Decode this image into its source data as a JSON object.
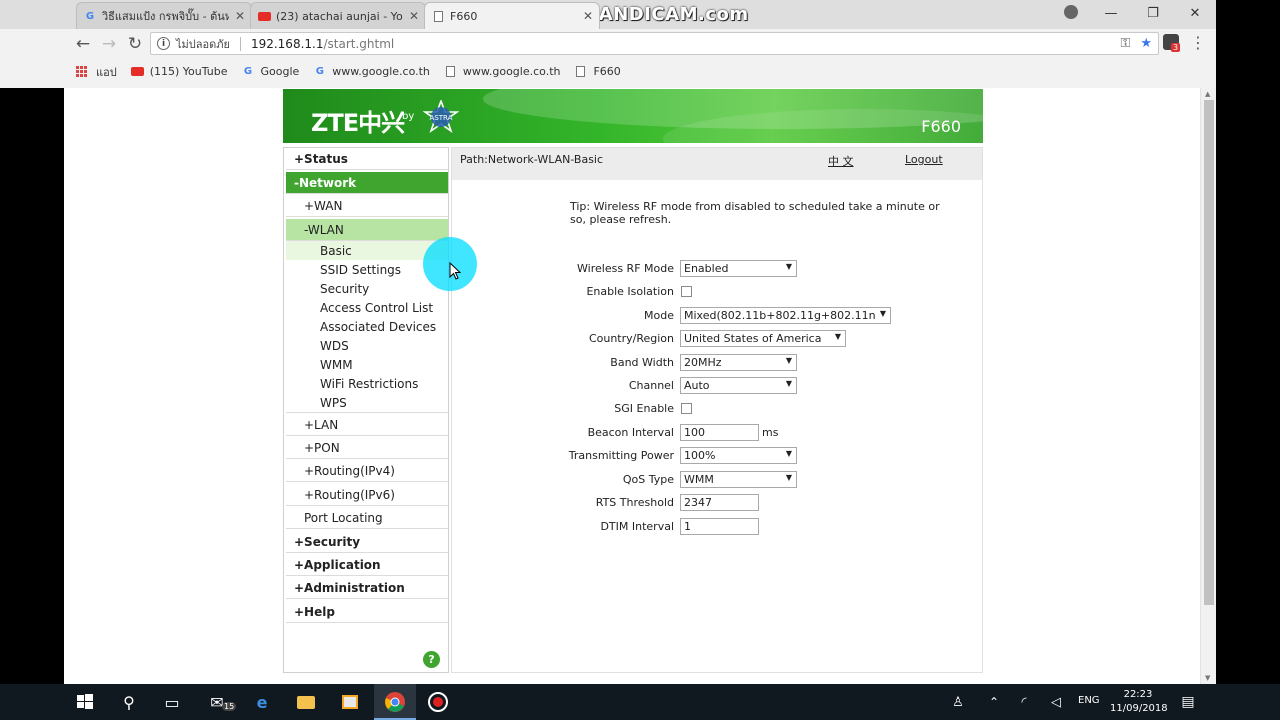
{
  "browser": {
    "tabs": [
      {
        "title": "วิธีแสมแป้ง กรพจิบั๊บ - ต้นหาด้",
        "icon": "google-icon"
      },
      {
        "title": "(23) atachai aunjai - YouT",
        "icon": "youtube-icon"
      },
      {
        "title": "F660",
        "icon": "page-icon"
      }
    ],
    "watermark": "www.BANDICAM.com",
    "security_label": "ไม่ปลอดภัย",
    "url_host": "192.168.1.1",
    "url_path": "/start.ghtml",
    "extension_badge": "3",
    "bookmarks": [
      {
        "label": "แอป",
        "icon": "apps-icon"
      },
      {
        "label": "(115) YouTube",
        "icon": "youtube-icon"
      },
      {
        "label": "Google",
        "icon": "google-icon"
      },
      {
        "label": "www.google.co.th",
        "icon": "google-icon"
      },
      {
        "label": "www.google.co.th",
        "icon": "page-icon"
      },
      {
        "label": "F660",
        "icon": "page-icon"
      }
    ]
  },
  "router": {
    "brand": "ZTE中兴",
    "by": "by",
    "model": "F660",
    "path": "Path:Network-WLAN-Basic",
    "language_link": "中 文",
    "logout_link": "Logout",
    "tip": "Tip: Wireless RF mode from disabled to scheduled take a minute or so, please refresh.",
    "menu": [
      {
        "label": "+Status"
      },
      {
        "label": "-Network"
      },
      {
        "label": "+WAN"
      },
      {
        "label": "-WLAN"
      },
      {
        "label": "Basic"
      },
      {
        "label": "SSID Settings"
      },
      {
        "label": "Security"
      },
      {
        "label": "Access Control List"
      },
      {
        "label": "Associated Devices"
      },
      {
        "label": "WDS"
      },
      {
        "label": "WMM"
      },
      {
        "label": "WiFi Restrictions"
      },
      {
        "label": "WPS"
      },
      {
        "label": "+LAN"
      },
      {
        "label": "+PON"
      },
      {
        "label": "+Routing(IPv4)"
      },
      {
        "label": "+Routing(IPv6)"
      },
      {
        "label": "Port Locating"
      },
      {
        "label": "+Security"
      },
      {
        "label": "+Application"
      },
      {
        "label": "+Administration"
      },
      {
        "label": "+Help"
      }
    ],
    "help_icon_text": "?",
    "form": {
      "rf_mode": {
        "label": "Wireless RF Mode",
        "value": "Enabled"
      },
      "isolation": {
        "label": "Enable Isolation",
        "checked": false
      },
      "mode": {
        "label": "Mode",
        "value": "Mixed(802.11b+802.11g+802.11n"
      },
      "country": {
        "label": "Country/Region",
        "value": "United States of America"
      },
      "bandwidth": {
        "label": "Band Width",
        "value": "20MHz"
      },
      "channel": {
        "label": "Channel",
        "value": "Auto"
      },
      "sgi": {
        "label": "SGI Enable",
        "checked": false
      },
      "beacon": {
        "label": "Beacon Interval",
        "value": "100",
        "unit": "ms"
      },
      "tx_power": {
        "label": "Transmitting Power",
        "value": "100%"
      },
      "qos": {
        "label": "QoS Type",
        "value": "WMM"
      },
      "rts": {
        "label": "RTS Threshold",
        "value": "2347"
      },
      "dtim": {
        "label": "DTIM Interval",
        "value": "1"
      }
    }
  },
  "taskbar": {
    "mail_badge": "15",
    "language": "ENG",
    "time": "22:23",
    "date": "11/09/2018"
  },
  "colors": {
    "zte_green": "#3fa52f",
    "wlan_highlight": "#b7e3a3",
    "cursor_highlight": "#00dcff"
  }
}
